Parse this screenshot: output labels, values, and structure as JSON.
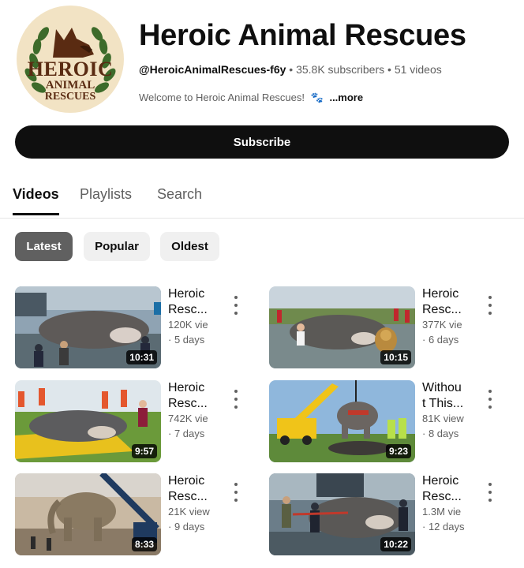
{
  "channel": {
    "title": "Heroic Animal Rescues",
    "handle": "@HeroicAnimalRescues-f6y",
    "subscribers": "35.8K subscribers",
    "videos_count": "51 videos",
    "description": "Welcome to Heroic Animal Rescues!",
    "more_label": "...more",
    "logo_lines": [
      "HEROIC",
      "ANIMAL",
      "RESCUES"
    ]
  },
  "subscribe_label": "Subscribe",
  "tabs": [
    {
      "label": "Videos",
      "active": true
    },
    {
      "label": "Playlists",
      "active": false
    },
    {
      "label": "Search",
      "active": false
    }
  ],
  "chips": [
    {
      "label": "Latest",
      "active": true
    },
    {
      "label": "Popular",
      "active": false
    },
    {
      "label": "Oldest",
      "active": false
    }
  ],
  "videos": [
    {
      "title_l1": "Heroic",
      "title_l2": "Resc...",
      "views": "120K vie",
      "age": "· 5 days",
      "duration": "10:31",
      "scene": "catfish-boat"
    },
    {
      "title_l1": "Heroic",
      "title_l2": "Resc...",
      "views": "377K vie",
      "age": "· 6 days",
      "duration": "10:15",
      "scene": "catfish-lion"
    },
    {
      "title_l1": "Heroic",
      "title_l2": "Resc...",
      "views": "742K vie",
      "age": "· 7 days",
      "duration": "9:57",
      "scene": "catfish-field"
    },
    {
      "title_l1": "Withou",
      "title_l2": "t This...",
      "views": "81K view",
      "age": "· 8 days",
      "duration": "9:23",
      "scene": "elephant-crane"
    },
    {
      "title_l1": "Heroic",
      "title_l2": "Resc...",
      "views": "21K view",
      "age": "· 9 days",
      "duration": "8:33",
      "scene": "elephant-rocks"
    },
    {
      "title_l1": "Heroic",
      "title_l2": "Resc...",
      "views": "1.3M vie",
      "age": "· 12 days",
      "duration": "10:22",
      "scene": "catfish-dock"
    }
  ]
}
